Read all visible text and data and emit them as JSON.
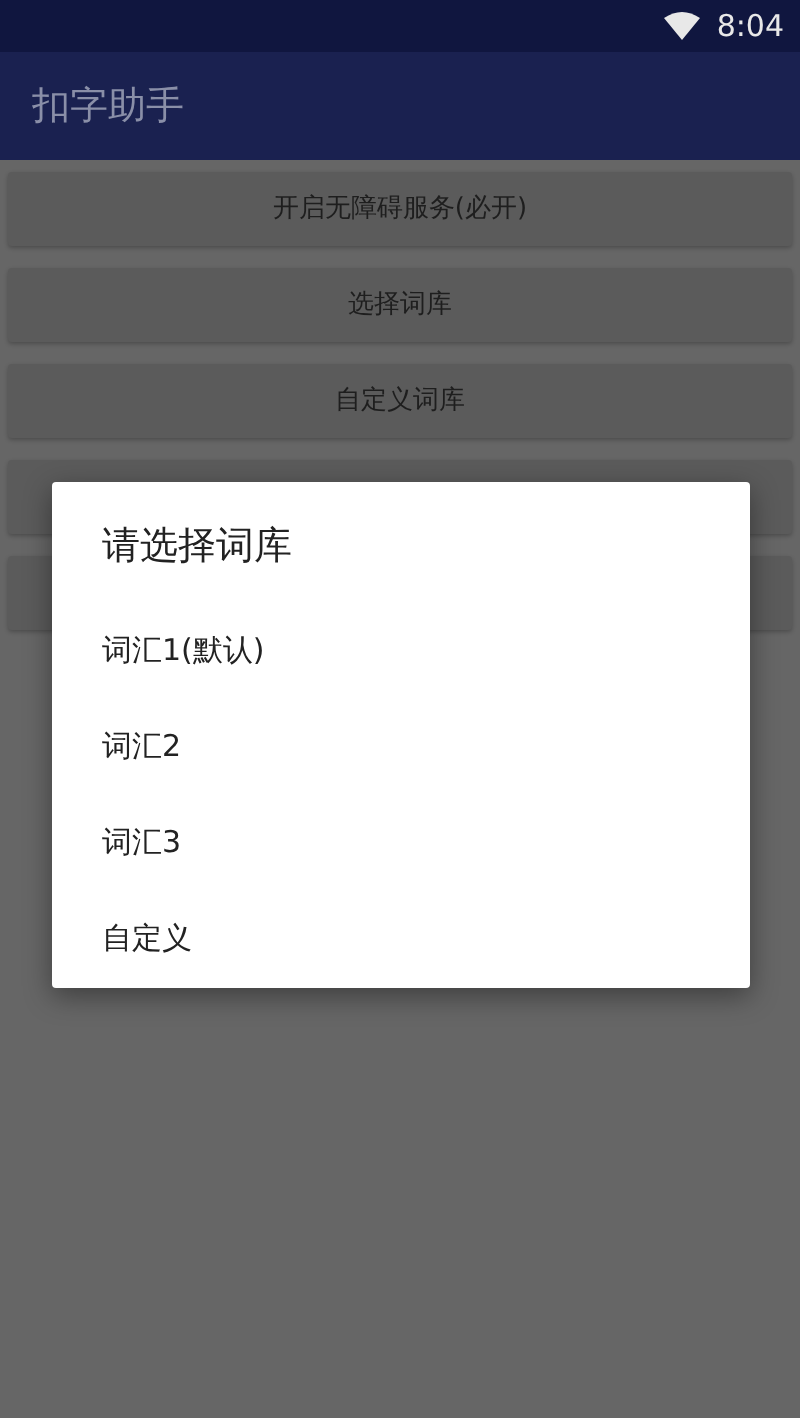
{
  "status_bar": {
    "time": "8:04"
  },
  "app_bar": {
    "title": "扣字助手"
  },
  "buttons": [
    {
      "kind": "button",
      "label": "开启无障碍服务(必开)"
    },
    {
      "kind": "button",
      "label": "选择词库"
    },
    {
      "kind": "button",
      "label": "自定义词库"
    },
    {
      "kind": "covered"
    },
    {
      "kind": "covered"
    }
  ],
  "dialog": {
    "title": "请选择词库",
    "items": [
      "词汇1(默认)",
      "词汇2",
      "词汇3",
      "自定义"
    ]
  }
}
